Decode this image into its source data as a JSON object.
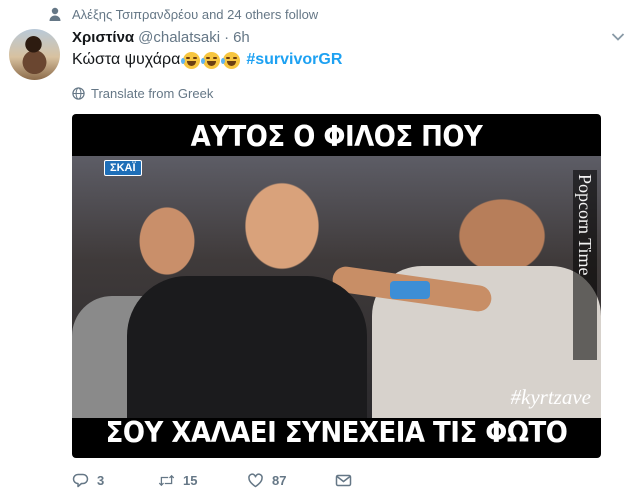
{
  "social_context": {
    "text": "Αλέξης Τσιπρανδρέου and 24 others follow"
  },
  "tweet": {
    "display_name": "Χριστίνα",
    "username": "@chalatsaki",
    "separator": "·",
    "time": "6h",
    "text": "Κώστα ψυχάρα",
    "emojis": [
      "face-with-tears-of-joy",
      "face-with-tears-of-joy",
      "face-with-tears-of-joy"
    ],
    "hashtag": "#survivorGR",
    "translate_label": "Translate from Greek"
  },
  "media": {
    "caption_top": "ΑΥΤΟΣ Ο ΦΙΛΟΣ ΠΟΥ",
    "caption_bottom": "ΣΟΥ ΧΑΛΑΕΙ ΣΥΝΕΧΕΙΑ ΤΙΣ ΦΩΤΟ",
    "channel_logo": "ΣΚΑΪ",
    "watermark": "Popcorn Time",
    "tag": "#kyrtzave"
  },
  "actions": {
    "replies": "3",
    "retweets": "15",
    "likes": "87"
  },
  "colors": {
    "link": "#1da1f2",
    "muted": "#657786",
    "text": "#14171a"
  }
}
